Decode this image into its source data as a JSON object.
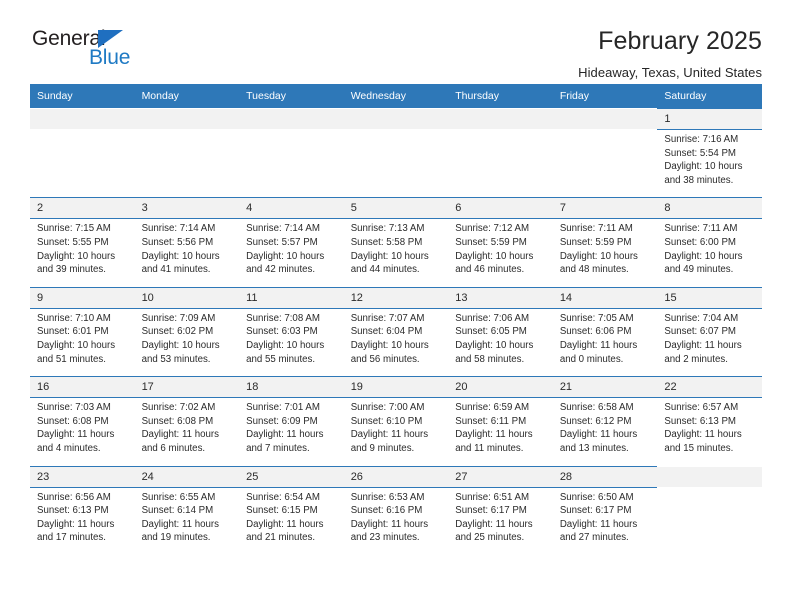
{
  "brand": {
    "name_top": "General",
    "name_bottom": "Blue",
    "triangle_icon": "triangle-icon",
    "color_text": "#231f20",
    "color_blue": "#1f7ac4"
  },
  "header": {
    "title": "February 2025",
    "subtitle": "Hideaway, Texas, United States"
  },
  "theme": {
    "header_blue": "#2e78b8",
    "daynum_bg": "#f2f2f2",
    "text": "#2b2b2b"
  },
  "calendar": {
    "weekday_headers": [
      "Sunday",
      "Monday",
      "Tuesday",
      "Wednesday",
      "Thursday",
      "Friday",
      "Saturday"
    ],
    "weeks": [
      [
        {
          "day": "",
          "empty": true
        },
        {
          "day": "",
          "empty": true
        },
        {
          "day": "",
          "empty": true
        },
        {
          "day": "",
          "empty": true
        },
        {
          "day": "",
          "empty": true
        },
        {
          "day": "",
          "empty": true
        },
        {
          "day": "1",
          "sunrise": "Sunrise: 7:16 AM",
          "sunset": "Sunset: 5:54 PM",
          "daylight": "Daylight: 10 hours and 38 minutes."
        }
      ],
      [
        {
          "day": "2",
          "sunrise": "Sunrise: 7:15 AM",
          "sunset": "Sunset: 5:55 PM",
          "daylight": "Daylight: 10 hours and 39 minutes."
        },
        {
          "day": "3",
          "sunrise": "Sunrise: 7:14 AM",
          "sunset": "Sunset: 5:56 PM",
          "daylight": "Daylight: 10 hours and 41 minutes."
        },
        {
          "day": "4",
          "sunrise": "Sunrise: 7:14 AM",
          "sunset": "Sunset: 5:57 PM",
          "daylight": "Daylight: 10 hours and 42 minutes."
        },
        {
          "day": "5",
          "sunrise": "Sunrise: 7:13 AM",
          "sunset": "Sunset: 5:58 PM",
          "daylight": "Daylight: 10 hours and 44 minutes."
        },
        {
          "day": "6",
          "sunrise": "Sunrise: 7:12 AM",
          "sunset": "Sunset: 5:59 PM",
          "daylight": "Daylight: 10 hours and 46 minutes."
        },
        {
          "day": "7",
          "sunrise": "Sunrise: 7:11 AM",
          "sunset": "Sunset: 5:59 PM",
          "daylight": "Daylight: 10 hours and 48 minutes."
        },
        {
          "day": "8",
          "sunrise": "Sunrise: 7:11 AM",
          "sunset": "Sunset: 6:00 PM",
          "daylight": "Daylight: 10 hours and 49 minutes."
        }
      ],
      [
        {
          "day": "9",
          "sunrise": "Sunrise: 7:10 AM",
          "sunset": "Sunset: 6:01 PM",
          "daylight": "Daylight: 10 hours and 51 minutes."
        },
        {
          "day": "10",
          "sunrise": "Sunrise: 7:09 AM",
          "sunset": "Sunset: 6:02 PM",
          "daylight": "Daylight: 10 hours and 53 minutes."
        },
        {
          "day": "11",
          "sunrise": "Sunrise: 7:08 AM",
          "sunset": "Sunset: 6:03 PM",
          "daylight": "Daylight: 10 hours and 55 minutes."
        },
        {
          "day": "12",
          "sunrise": "Sunrise: 7:07 AM",
          "sunset": "Sunset: 6:04 PM",
          "daylight": "Daylight: 10 hours and 56 minutes."
        },
        {
          "day": "13",
          "sunrise": "Sunrise: 7:06 AM",
          "sunset": "Sunset: 6:05 PM",
          "daylight": "Daylight: 10 hours and 58 minutes."
        },
        {
          "day": "14",
          "sunrise": "Sunrise: 7:05 AM",
          "sunset": "Sunset: 6:06 PM",
          "daylight": "Daylight: 11 hours and 0 minutes."
        },
        {
          "day": "15",
          "sunrise": "Sunrise: 7:04 AM",
          "sunset": "Sunset: 6:07 PM",
          "daylight": "Daylight: 11 hours and 2 minutes."
        }
      ],
      [
        {
          "day": "16",
          "sunrise": "Sunrise: 7:03 AM",
          "sunset": "Sunset: 6:08 PM",
          "daylight": "Daylight: 11 hours and 4 minutes."
        },
        {
          "day": "17",
          "sunrise": "Sunrise: 7:02 AM",
          "sunset": "Sunset: 6:08 PM",
          "daylight": "Daylight: 11 hours and 6 minutes."
        },
        {
          "day": "18",
          "sunrise": "Sunrise: 7:01 AM",
          "sunset": "Sunset: 6:09 PM",
          "daylight": "Daylight: 11 hours and 7 minutes."
        },
        {
          "day": "19",
          "sunrise": "Sunrise: 7:00 AM",
          "sunset": "Sunset: 6:10 PM",
          "daylight": "Daylight: 11 hours and 9 minutes."
        },
        {
          "day": "20",
          "sunrise": "Sunrise: 6:59 AM",
          "sunset": "Sunset: 6:11 PM",
          "daylight": "Daylight: 11 hours and 11 minutes."
        },
        {
          "day": "21",
          "sunrise": "Sunrise: 6:58 AM",
          "sunset": "Sunset: 6:12 PM",
          "daylight": "Daylight: 11 hours and 13 minutes."
        },
        {
          "day": "22",
          "sunrise": "Sunrise: 6:57 AM",
          "sunset": "Sunset: 6:13 PM",
          "daylight": "Daylight: 11 hours and 15 minutes."
        }
      ],
      [
        {
          "day": "23",
          "sunrise": "Sunrise: 6:56 AM",
          "sunset": "Sunset: 6:13 PM",
          "daylight": "Daylight: 11 hours and 17 minutes."
        },
        {
          "day": "24",
          "sunrise": "Sunrise: 6:55 AM",
          "sunset": "Sunset: 6:14 PM",
          "daylight": "Daylight: 11 hours and 19 minutes."
        },
        {
          "day": "25",
          "sunrise": "Sunrise: 6:54 AM",
          "sunset": "Sunset: 6:15 PM",
          "daylight": "Daylight: 11 hours and 21 minutes."
        },
        {
          "day": "26",
          "sunrise": "Sunrise: 6:53 AM",
          "sunset": "Sunset: 6:16 PM",
          "daylight": "Daylight: 11 hours and 23 minutes."
        },
        {
          "day": "27",
          "sunrise": "Sunrise: 6:51 AM",
          "sunset": "Sunset: 6:17 PM",
          "daylight": "Daylight: 11 hours and 25 minutes."
        },
        {
          "day": "28",
          "sunrise": "Sunrise: 6:50 AM",
          "sunset": "Sunset: 6:17 PM",
          "daylight": "Daylight: 11 hours and 27 minutes."
        },
        {
          "day": "",
          "empty": true
        }
      ]
    ]
  }
}
